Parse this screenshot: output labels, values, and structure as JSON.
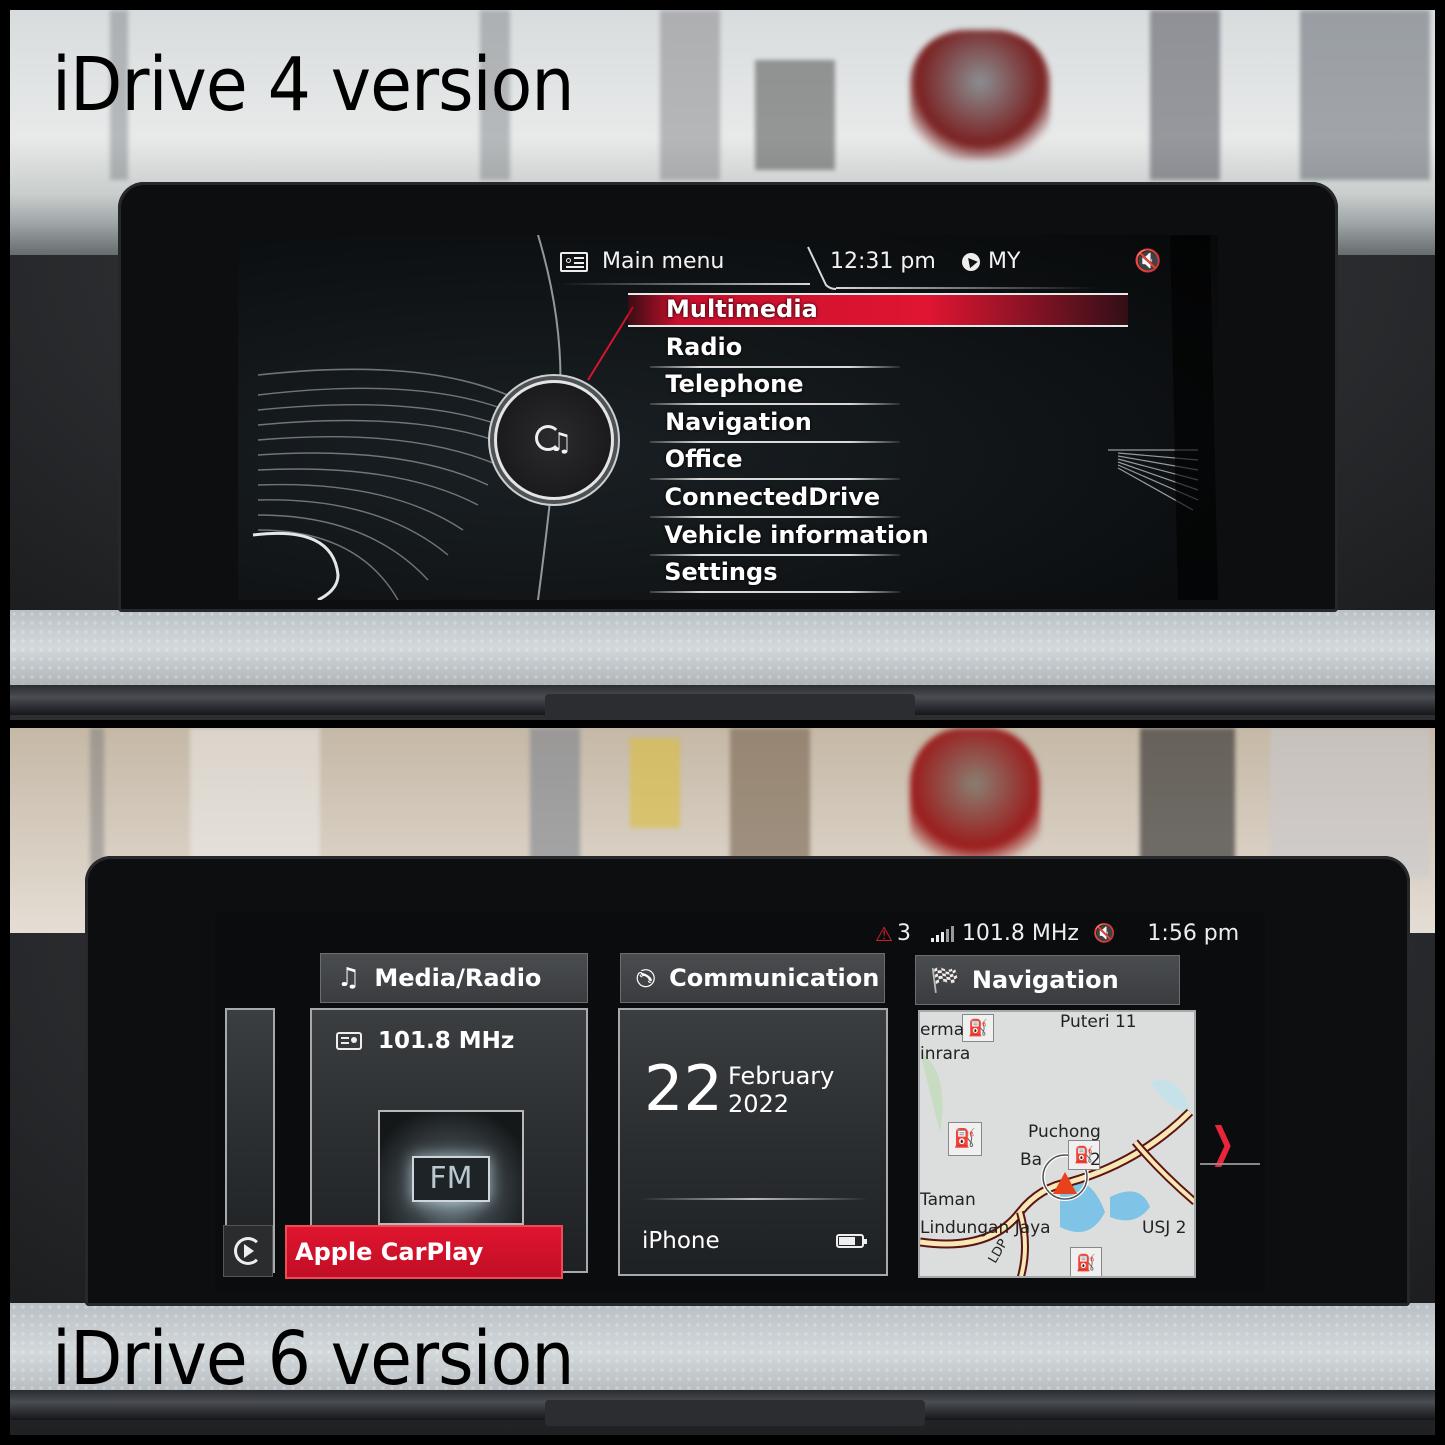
{
  "captions": {
    "top": "iDrive 4 version",
    "bottom": "iDrive 6 version"
  },
  "idrive4": {
    "header": {
      "menu_icon": "main-menu-icon",
      "title": "Main menu",
      "time": "12:31 pm",
      "region_icon": "navigation-arrow-icon",
      "region": "MY",
      "mute_icon": "speaker-muted-icon"
    },
    "center_icon": "multimedia-music-icon",
    "menu": [
      {
        "label": "Multimedia",
        "selected": true
      },
      {
        "label": "Radio",
        "selected": false
      },
      {
        "label": "Telephone",
        "selected": false
      },
      {
        "label": "Navigation",
        "selected": false
      },
      {
        "label": "Office",
        "selected": false
      },
      {
        "label": "ConnectedDrive",
        "selected": false
      },
      {
        "label": "Vehicle information",
        "selected": false
      },
      {
        "label": "Settings",
        "selected": false
      }
    ],
    "accent_color": "#d8132f"
  },
  "idrive6": {
    "status_bar": {
      "warning_icon": "warning-triangle-icon",
      "warning_count": "3",
      "signal_icon": "signal-bars-icon",
      "frequency": "101.8 MHz",
      "mute_icon": "speaker-muted-icon",
      "time": "1:56 pm"
    },
    "tiles": {
      "media": {
        "title": "Media/Radio",
        "icon": "music-note-icon",
        "station_icon": "radio-icon",
        "station": "101.8 MHz",
        "band": "FM",
        "source_icon": "carplay-play-icon",
        "source": "Apple CarPlay"
      },
      "communication": {
        "title": "Communication",
        "icon": "phone-handset-icon",
        "day": "22",
        "month": "February",
        "year": "2022",
        "device": "iPhone",
        "battery_icon": "battery-icon"
      },
      "navigation": {
        "title": "Navigation",
        "icon": "checkered-flag-icon",
        "map_labels": [
          "Puteri 11",
          "erma",
          "inrara",
          "Puchong",
          "Ba",
          "2",
          "Taman",
          "Lindungan Jaya",
          "USJ 2",
          "LDP"
        ],
        "next_icon": "chevron-right-icon"
      }
    },
    "accent_color": "#d8132f"
  }
}
